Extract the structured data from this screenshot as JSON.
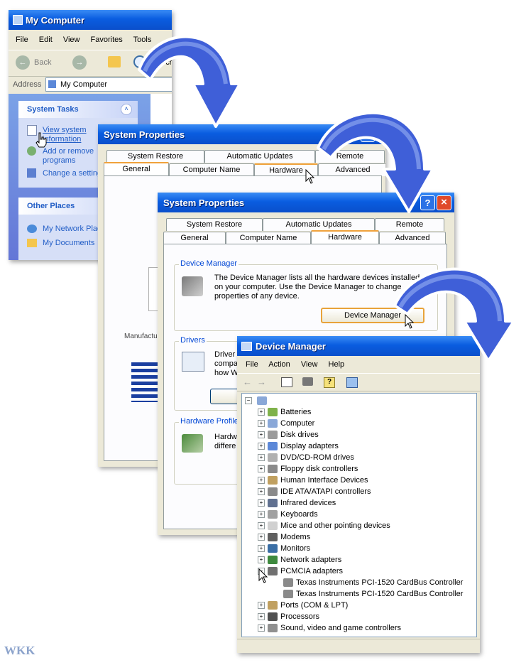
{
  "my_computer": {
    "title": "My Computer",
    "menu": [
      "File",
      "Edit",
      "View",
      "Favorites",
      "Tools"
    ],
    "back_label": "Back",
    "search_label": "Search",
    "address_label": "Address",
    "address_value": "My Computer",
    "system_tasks_title": "System Tasks",
    "tasks": [
      "View system information",
      "Add or remove programs",
      "Change a setting"
    ],
    "other_places_title": "Other Places",
    "places": [
      "My Network Places",
      "My Documents"
    ]
  },
  "sys_props_back": {
    "title": "System Properties",
    "tabs_top": [
      "System Restore",
      "Automatic Updates",
      "Remote"
    ],
    "tabs_bottom": [
      "General",
      "Computer Name",
      "Hardware",
      "Advanced"
    ],
    "manufacturer_label": "Manufactu"
  },
  "sys_props_front": {
    "title": "System Properties",
    "help_icon": "?",
    "close_icon": "×",
    "tabs_top": [
      "System Restore",
      "Automatic Updates",
      "Remote"
    ],
    "tabs_bottom": [
      "General",
      "Computer Name",
      "Hardware",
      "Advanced"
    ],
    "device_manager_group": "Device Manager",
    "device_manager_text": "The Device Manager lists all the hardware devices installed on your computer. Use the Device Manager to change properties of any device.",
    "device_manager_button": "Device Manager",
    "drivers_group": "Drivers",
    "drivers_text": "Driver compa how W",
    "hw_profiles_group": "Hardware Profiles",
    "hw_profiles_text": "Hardw differe"
  },
  "device_manager": {
    "title": "Device Manager",
    "menu": [
      "File",
      "Action",
      "View",
      "Help"
    ],
    "categories": [
      "Batteries",
      "Computer",
      "Disk drives",
      "Display adapters",
      "DVD/CD-ROM drives",
      "Floppy disk controllers",
      "Human Interface Devices",
      "IDE ATA/ATAPI controllers",
      "Infrared devices",
      "Keyboards",
      "Mice and other pointing devices",
      "Modems",
      "Monitors",
      "Network adapters",
      "PCMCIA adapters"
    ],
    "pcmcia_children": [
      "Texas Instruments PCI-1520 CardBus Controller",
      "Texas Instruments PCI-1520 CardBus Controller"
    ],
    "after": [
      "Ports (COM & LPT)",
      "Processors",
      "Sound, video and game controllers"
    ]
  },
  "watermark": "WKK",
  "colors": {
    "xp_title_blue": "#0a5de0",
    "tab_orange": "#f0a23c",
    "group_label_blue": "#0046d5",
    "arrow_fill": "#3f5fd8"
  }
}
